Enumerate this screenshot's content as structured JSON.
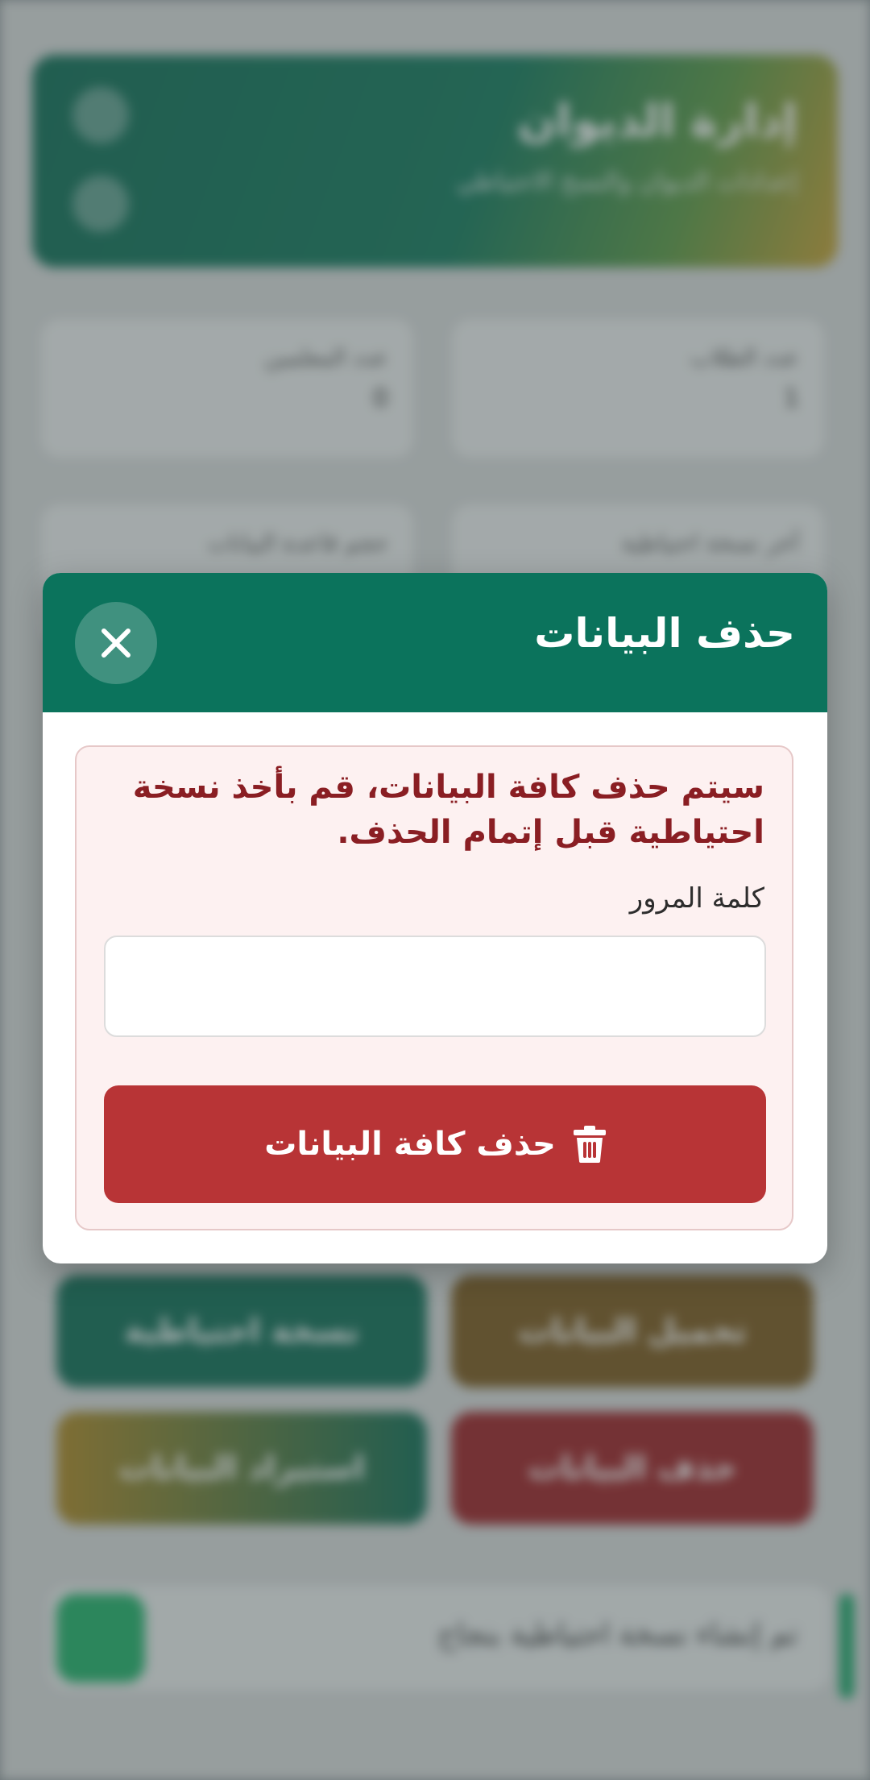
{
  "background": {
    "header_title": "إدارة الديوان",
    "header_subtitle": "إعدادات الديوان والنسخ الاحتياطي",
    "cards": [
      {
        "label": "عدد الطلاب",
        "value": "1"
      },
      {
        "label": "عدد المعلمين",
        "value": "0"
      },
      {
        "label": "آخر نسخة احتياطية",
        "value": ""
      },
      {
        "label": "حجم قاعدة البيانات",
        "value": ""
      }
    ],
    "buttons": [
      {
        "label": "تحميل البيانات",
        "color": "#7d5a1e"
      },
      {
        "label": "نسخة احتياطية",
        "color": "#0f6e55"
      },
      {
        "label": "حذف البيانات",
        "color": "#9e2326"
      },
      {
        "label": "استيراد البيانات",
        "color": "#b08a25"
      }
    ],
    "footer_text": "تم إنشاء نسخة احتياطية بنجاح"
  },
  "modal": {
    "title": "حذف البيانات",
    "close_icon": "close-icon",
    "warning_text": "سيتم حذف كافة البيانات، قم بأخذ نسخة احتياطية قبل إتمام الحذف.",
    "password_label": "كلمة المرور",
    "password_value": "",
    "password_placeholder": "",
    "delete_button_label": "حذف كافة البيانات",
    "delete_icon": "trash-icon"
  },
  "colors": {
    "header_green": "#0b735c",
    "danger_red": "#b83436",
    "alert_bg": "#fdf1f1",
    "alert_text": "#8a1e23"
  }
}
